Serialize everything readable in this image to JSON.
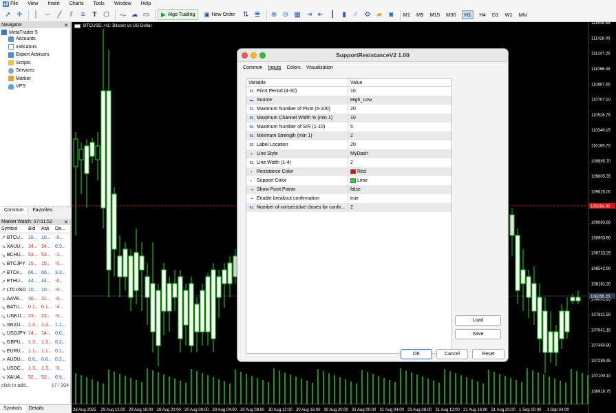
{
  "menu": [
    "File",
    "View",
    "Insert",
    "Charts",
    "Tools",
    "Window",
    "Help"
  ],
  "toolbar": {
    "algo_trading_label": "Algo Trading",
    "new_order_label": "New Order",
    "timeframes": [
      "M1",
      "M5",
      "M15",
      "M30",
      "H1",
      "H4",
      "D1",
      "W1",
      "MN"
    ],
    "active_timeframe": "H1"
  },
  "navigator": {
    "title": "Navigator",
    "root": "MetaTrader 5",
    "items": [
      "Accounts",
      "Indicators",
      "Expert Advisors",
      "Scripts",
      "Services",
      "Market",
      "VPS"
    ],
    "tabs": [
      "Common",
      "Favorites"
    ]
  },
  "market_watch": {
    "title": "Market Watch: 07:01:52",
    "columns": [
      "Symbol",
      "Bid",
      "Ask",
      "Da..."
    ],
    "rows": [
      {
        "symbol": "BTCU...",
        "bid": "10...",
        "ask": "10...",
        "daily": "-0...",
        "dir": "up"
      },
      {
        "symbol": "XAUU...",
        "bid": "34...",
        "ask": "34...",
        "daily": "0.3...",
        "dir": "dn"
      },
      {
        "symbol": "BCHU...",
        "bid": "53...",
        "ask": "53...",
        "daily": "-1...",
        "dir": "dn"
      },
      {
        "symbol": "BTCJPY",
        "bid": "15...",
        "ask": "15...",
        "daily": "-0...",
        "dir": "dn"
      },
      {
        "symbol": "BTCK...",
        "bid": "66...",
        "ask": "66...",
        "daily": "3.3...",
        "dir": "up"
      },
      {
        "symbol": "ETHU...",
        "bid": "44...",
        "ask": "44...",
        "daily": "-0...",
        "dir": "up"
      },
      {
        "symbol": "LTCUSD",
        "bid": "10...",
        "ask": "10...",
        "daily": "-0...",
        "dir": "up"
      },
      {
        "symbol": "AAVE...",
        "bid": "30...",
        "ask": "31...",
        "daily": "-0...",
        "dir": "dn"
      },
      {
        "symbol": "BATU...",
        "bid": "0.1...",
        "ask": "0.1...",
        "daily": "-4...",
        "dir": "dn"
      },
      {
        "symbol": "LINKU...",
        "bid": "23...",
        "ask": "23...",
        "daily": "-0...",
        "dir": "dn"
      },
      {
        "symbol": "SNXU...",
        "bid": "1.4...",
        "ask": "1.4...",
        "daily": "1.1...",
        "dir": "dn"
      },
      {
        "symbol": "USDJPY",
        "bid": "14...",
        "ask": "14...",
        "daily": "0.0...",
        "dir": "dn"
      },
      {
        "symbol": "GBPU...",
        "bid": "1.3...",
        "ask": "1.3...",
        "daily": "0.2...",
        "dir": "dn"
      },
      {
        "symbol": "EURU...",
        "bid": "1.1...",
        "ask": "1.1...",
        "daily": "0.1...",
        "dir": "dn"
      },
      {
        "symbol": "AUDU...",
        "bid": "0.6...",
        "ask": "0.6...",
        "daily": "0.2...",
        "dir": "up"
      },
      {
        "symbol": "USDC...",
        "bid": "1.3...",
        "ask": "1.3...",
        "daily": "-0...",
        "dir": "dn"
      },
      {
        "symbol": "XAUA...",
        "bid": "52...",
        "ask": "52...",
        "daily": "0.9...",
        "dir": "dn"
      }
    ],
    "add_label": "click to add...",
    "count": "17 / 304",
    "tabs": [
      "Symbols",
      "Details"
    ]
  },
  "chart": {
    "title": "BTCUSD, H1: Bitcoin vs US Dollar",
    "price_labels": [
      "111608.85",
      "111428.05",
      "111247.25",
      "111066.45",
      "110887.65",
      "110707.10",
      "110526.75",
      "110346.15",
      "110165.70",
      "109985.70",
      "109805.35",
      "109625.00",
      "109444.65",
      "109083.60",
      "108903.60",
      "108723.25",
      "108542.90",
      "108182.20",
      "108001.85",
      "107821.50",
      "107641.15",
      "107460.80",
      "107280.45",
      "107100.10",
      "106919.75"
    ],
    "resistance_label": "109264.00",
    "current_label": "108255.20",
    "time_labels": [
      "28 Aug 2025",
      "29 Aug 12:00",
      "29 Aug 16:00",
      "29 Aug 20:00",
      "30 Aug 00:00",
      "30 Aug 04:00",
      "30 Aug 08:00",
      "30 Aug 12:00",
      "30 Aug 16:00",
      "30 Aug 20:00",
      "31 Aug 00:00",
      "31 Aug 04:00",
      "31 Aug 08:00",
      "31 Aug 12:00",
      "31 Aug 16:00",
      "31 Aug 20:00",
      "1 Sep 00:00",
      "1 Sep 04:00"
    ]
  },
  "dialog": {
    "title": "SupportResistanceV2 1.00",
    "tabs": [
      "Common",
      "Inputs",
      "Colors",
      "Visualization"
    ],
    "active_tab": "Inputs",
    "col_variable": "Variable",
    "col_value": "Value",
    "params": [
      {
        "icon": "01",
        "name": "Pivot Period (4-30)",
        "value": "10"
      },
      {
        "icon": "src",
        "name": "Source",
        "value": "High_Low"
      },
      {
        "icon": "01",
        "name": "Maximum Number of Pivot (5-100)",
        "value": "20"
      },
      {
        "icon": "01",
        "name": "Maximum Channel Width % (min 1)",
        "value": "10"
      },
      {
        "icon": "01",
        "name": "Maximum Number of S/R (1-10)",
        "value": "5"
      },
      {
        "icon": "01",
        "name": "Minimum Strength (min 1)",
        "value": "2"
      },
      {
        "icon": "01",
        "name": "Label Location",
        "value": "20"
      },
      {
        "icon": "style",
        "name": "Line Style",
        "value": "MyDash"
      },
      {
        "icon": "01",
        "name": "Line Width (1-4)",
        "value": "2"
      },
      {
        "icon": "color",
        "name": "Resistance Color",
        "value": "Red",
        "swatch": "#e01010"
      },
      {
        "icon": "color",
        "name": "Support Color",
        "value": "Lime",
        "swatch": "#22dd22"
      },
      {
        "icon": "bool",
        "name": "Show Pivot Points",
        "value": "false"
      },
      {
        "icon": "bool",
        "name": "Enable breakout confirmation",
        "value": "true"
      },
      {
        "icon": "01",
        "name": "Number of consecutive closes for confir...",
        "value": "2"
      }
    ],
    "load_label": "Load",
    "save_label": "Save",
    "ok_label": "OK",
    "cancel_label": "Cancel",
    "reset_label": "Reset"
  }
}
